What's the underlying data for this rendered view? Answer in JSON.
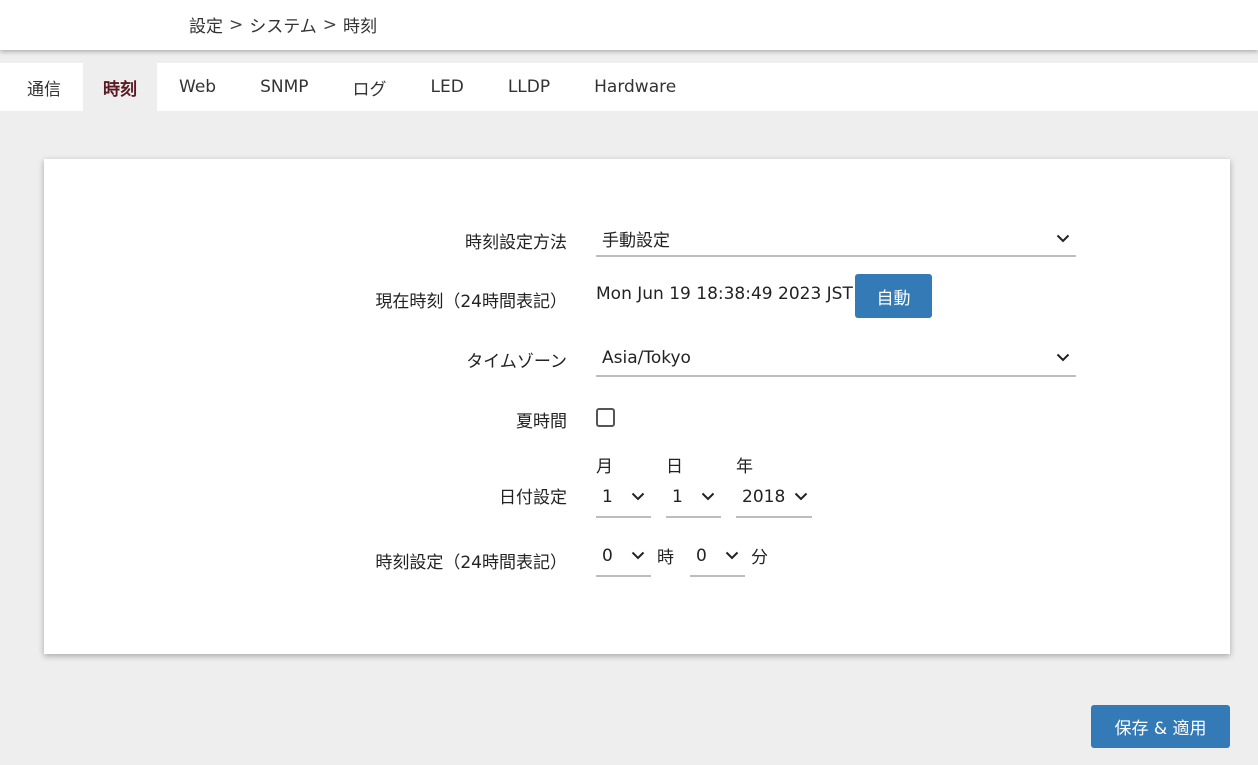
{
  "breadcrumb": [
    "設定",
    "システム",
    "時刻"
  ],
  "breadcrumb_sep": ">",
  "tabs": [
    {
      "label": "通信"
    },
    {
      "label": "時刻",
      "active": true
    },
    {
      "label": "Web"
    },
    {
      "label": "SNMP"
    },
    {
      "label": "ログ"
    },
    {
      "label": "LED"
    },
    {
      "label": "LLDP"
    },
    {
      "label": "Hardware"
    }
  ],
  "form": {
    "method_label": "時刻設定方法",
    "method_value": "手動設定",
    "current_time_label": "現在時刻（24時間表記）",
    "current_time_value": "Mon Jun 19 18:38:49 2023 JST",
    "auto_button": "自動",
    "timezone_label": "タイムゾーン",
    "timezone_value": "Asia/Tokyo",
    "dst_label": "夏時間",
    "dst_checked": false,
    "date_label": "日付設定",
    "month_header": "月",
    "day_header": "日",
    "year_header": "年",
    "month_value": "1",
    "day_value": "1",
    "year_value": "2018",
    "time_label": "時刻設定（24時間表記）",
    "hour_value": "0",
    "hour_unit": "時",
    "minute_value": "0",
    "minute_unit": "分"
  },
  "save_button": "保存 & 適用",
  "colors": {
    "accent": "#337ab7",
    "active_tab_text": "#5a1a24",
    "background": "#eeeeee"
  }
}
